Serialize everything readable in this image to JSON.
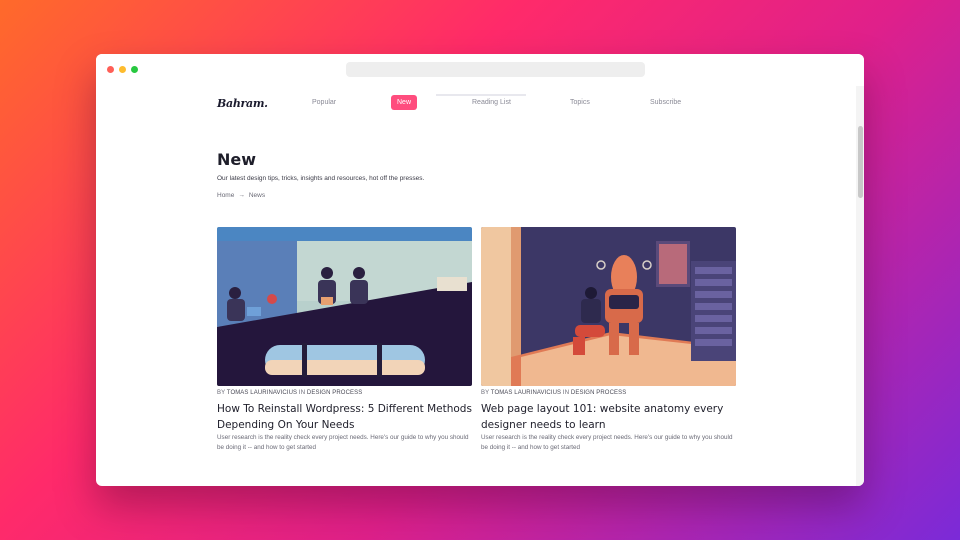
{
  "window": {
    "url": ""
  },
  "nav": {
    "logo": "Bahram.",
    "items": [
      {
        "label": "Popular",
        "active": false
      },
      {
        "label": "New",
        "active": true
      },
      {
        "label": "Reading List",
        "active": false
      },
      {
        "label": "Topics",
        "active": false
      },
      {
        "label": "Subscribe",
        "active": false
      }
    ],
    "accent": "#ff4d7e"
  },
  "header": {
    "title": "New",
    "intro": "Our latest design tips, tricks, insights and resources, hot off the presses.",
    "breadcrumb": {
      "home": "Home",
      "separator": "→",
      "current": "News"
    }
  },
  "articles": [
    {
      "by": "BY",
      "author": "TOMAS LAURINAVICIUS",
      "in": "IN",
      "category": "DESIGN PROCESS",
      "title": "How To Reinstall Wordpress: 5 Different Methods Depending On Your Needs",
      "description": "User research is the reality check every project needs. Here's our guide to why you should be doing it -- and how to get started",
      "image": "office-team-illustration"
    },
    {
      "by": "BY",
      "author": "TOMAS LAURINAVICIUS",
      "in": "IN",
      "category": "DESIGN PROCESS",
      "title": "Web page layout 101: website anatomy every designer needs to learn",
      "description": "User research is the reality check every project needs. Here's our guide to why you should be doing it -- and how to get started",
      "image": "robot-repair-illustration"
    }
  ]
}
